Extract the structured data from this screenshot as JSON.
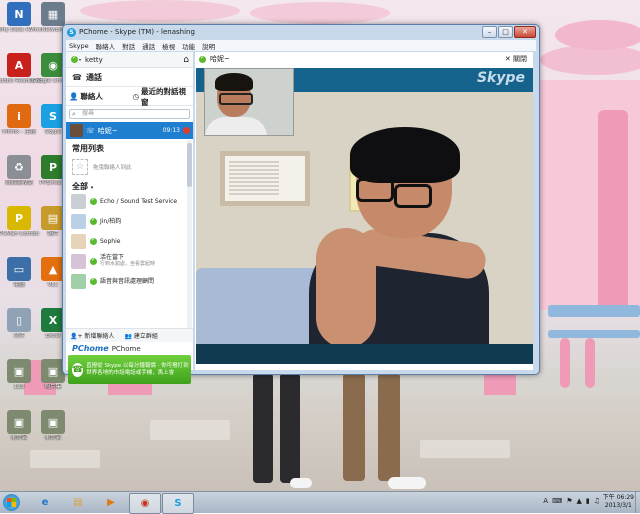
{
  "desktop": {
    "icons": [
      {
        "name": "nifty-icon",
        "label": "Nifty Data (Win).lnk",
        "glyph": "N",
        "color": "#2f6fbd"
      },
      {
        "name": "network-shortcut-icon",
        "label": "Network",
        "glyph": "▦",
        "color": "#6b7c8c"
      },
      {
        "name": "adobe-reader-icon",
        "label": "Adobe Reader XI",
        "glyph": "A",
        "color": "#c8211b"
      },
      {
        "name": "google-chrome-icon",
        "label": "Google Chrome",
        "glyph": "◉",
        "color": "#3a8d3a"
      },
      {
        "name": "infinix-icon",
        "label": "Infinix - 主题",
        "glyph": "i",
        "color": "#e06a12"
      },
      {
        "name": "skype-desktop-icon",
        "label": "Skype",
        "glyph": "S",
        "color": "#1aa0e3"
      },
      {
        "name": "recycle-bin-icon",
        "label": "資源回收筒",
        "glyph": "♻",
        "color": "#8a8f96"
      },
      {
        "name": "ppstream-icon",
        "label": "PPStream",
        "glyph": "P",
        "color": "#2d7d2d"
      },
      {
        "name": "pcman-icon",
        "label": "PCMan Combo",
        "glyph": "P",
        "color": "#d8b800"
      },
      {
        "name": "folder-icon",
        "label": "照片",
        "glyph": "▤",
        "color": "#c79b2b"
      },
      {
        "name": "computer-icon",
        "label": "電腦",
        "glyph": "▭",
        "color": "#3c6fa8"
      },
      {
        "name": "vlc-icon",
        "label": "VLC",
        "glyph": "▲",
        "color": "#e36f0e"
      },
      {
        "name": "file-icon",
        "label": "文件",
        "glyph": "▯",
        "color": "#90a2b6"
      },
      {
        "name": "excel-icon",
        "label": "Excel",
        "glyph": "X",
        "color": "#1f7a3d"
      },
      {
        "name": "photo-file-icon",
        "label": "123",
        "glyph": "▣",
        "color": "#7d8a6f"
      },
      {
        "name": "photo-file-icon-2",
        "label": "照片集",
        "glyph": "▣",
        "color": "#7d8a6f"
      },
      {
        "name": "photo-file-icon-3",
        "label": "未命名",
        "glyph": "▣",
        "color": "#7d8a6f"
      },
      {
        "name": "photo-file-icon-4",
        "label": "未命名",
        "glyph": "▣",
        "color": "#7d8a6f"
      }
    ]
  },
  "window": {
    "title": "PChome - Skype (TM) - lenashing",
    "menu": [
      "Skype",
      "聯絡人",
      "對話",
      "通話",
      "檢視",
      "功能",
      "說明"
    ],
    "left": {
      "user": "ketty",
      "home_icon": "⌂",
      "call_label": "通話",
      "tab_contacts": "聯絡人",
      "tab_recent": "最近的對話視窗",
      "search_placeholder": "搜尋",
      "active_contact": "哈妮~",
      "active_time": "09:13",
      "favorites_title": "常用列表",
      "favorites_hint": "拖曳聯絡人到此",
      "all_title": "全部",
      "contacts": [
        {
          "name": "Echo / Sound Test Service",
          "sub": ""
        },
        {
          "name": "Jin/柏鈞",
          "sub": ""
        },
        {
          "name": "Sophie",
          "sub": ""
        },
        {
          "name": "活在當下",
          "sub": "行到水窮處，坐看雲起時"
        },
        {
          "name": "語音與音訊處理顧問",
          "sub": ""
        }
      ],
      "add_contact": "新增聯絡人",
      "create_group": "建立群組",
      "brand_logo": "PChome",
      "brand_name": "PChome",
      "ad_text": "直撥從 Skype 以每分鐘報價 · 你可撥打到世界各地的市話電話或手機，馬上會"
    },
    "call": {
      "contact": "哈妮~",
      "hangup": "關閉",
      "watermark": "Skype"
    }
  },
  "taskbar": {
    "apps": [
      {
        "name": "internet-explorer-icon",
        "glyph": "e",
        "color": "#1e78c8",
        "active": false
      },
      {
        "name": "file-explorer-icon",
        "glyph": "▤",
        "color": "#d6a23a",
        "active": false
      },
      {
        "name": "media-player-icon",
        "glyph": "▶",
        "color": "#e27a1a",
        "active": false
      },
      {
        "name": "chrome-taskbar-icon",
        "glyph": "◉",
        "color": "#c8321d",
        "active": true
      },
      {
        "name": "skype-taskbar-icon",
        "glyph": "S",
        "color": "#1aa0e3",
        "active": true
      }
    ],
    "tray": [
      "A",
      "⌨",
      "⚑",
      "▲",
      "▮",
      "♫"
    ],
    "time": "下午 06:29",
    "date": "2013/3/1"
  }
}
